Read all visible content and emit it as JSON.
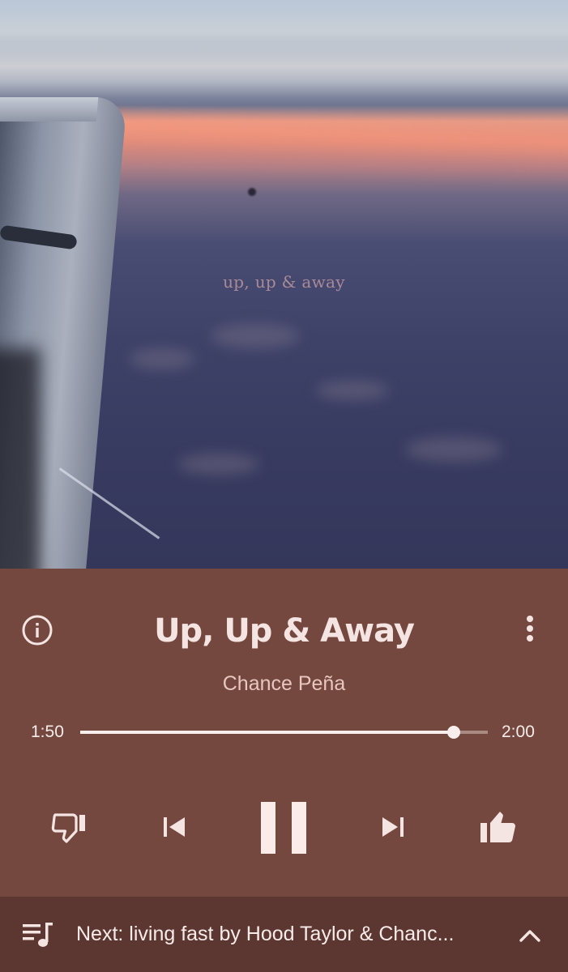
{
  "album_art": {
    "overlay_text": "up, up & away"
  },
  "player": {
    "title": "Up, Up & Away",
    "artist": "Chance Peña",
    "elapsed": "1:50",
    "duration": "2:00",
    "progress_fraction": 0.917,
    "is_playing": true
  },
  "controls": {
    "info_icon": "info-icon",
    "more_icon": "more-vertical-icon",
    "dislike_icon": "thumbs-down-icon",
    "previous_icon": "skip-previous-icon",
    "play_pause_icon": "pause-icon",
    "next_icon": "skip-next-icon",
    "like_icon": "thumbs-up-icon"
  },
  "up_next": {
    "queue_icon": "queue-music-icon",
    "text": "Next: living fast by Hood Taylor & Chanc...",
    "expand_icon": "chevron-up-icon"
  },
  "colors": {
    "panel_background": "#74483f",
    "next_bar_background": "#5c3630",
    "title_text": "#f4e4e2",
    "artist_text": "#e9c6bf"
  }
}
